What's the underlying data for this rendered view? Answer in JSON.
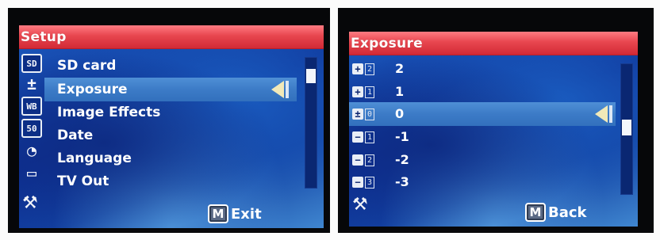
{
  "setup_screen": {
    "title": "Setup",
    "side_icons": [
      "SD",
      "+/-",
      "WB",
      "50",
      "cam",
      "TV"
    ],
    "items": [
      {
        "label": "SD card"
      },
      {
        "label": "Exposure"
      },
      {
        "label": "Image Effects"
      },
      {
        "label": "Date"
      },
      {
        "label": "Language"
      },
      {
        "label": "TV Out"
      }
    ],
    "selected_index": 1,
    "key_hint": {
      "key": "M",
      "label": "Exit"
    }
  },
  "exposure_screen": {
    "title": "Exposure",
    "items": [
      {
        "sign": "+",
        "num": "2",
        "label": "2"
      },
      {
        "sign": "+",
        "num": "1",
        "label": "1"
      },
      {
        "sign": "±",
        "num": "0",
        "label": "0"
      },
      {
        "sign": "−",
        "num": "1",
        "label": "-1"
      },
      {
        "sign": "−",
        "num": "2",
        "label": "-2"
      },
      {
        "sign": "−",
        "num": "3",
        "label": "-3"
      }
    ],
    "selected_index": 2,
    "key_hint": {
      "key": "M",
      "label": "Back"
    }
  },
  "colors": {
    "title_bar": "#e8464f",
    "selection": "#3c7bc7",
    "background": "#0d2f93",
    "arrow": "#f1e9b8"
  }
}
